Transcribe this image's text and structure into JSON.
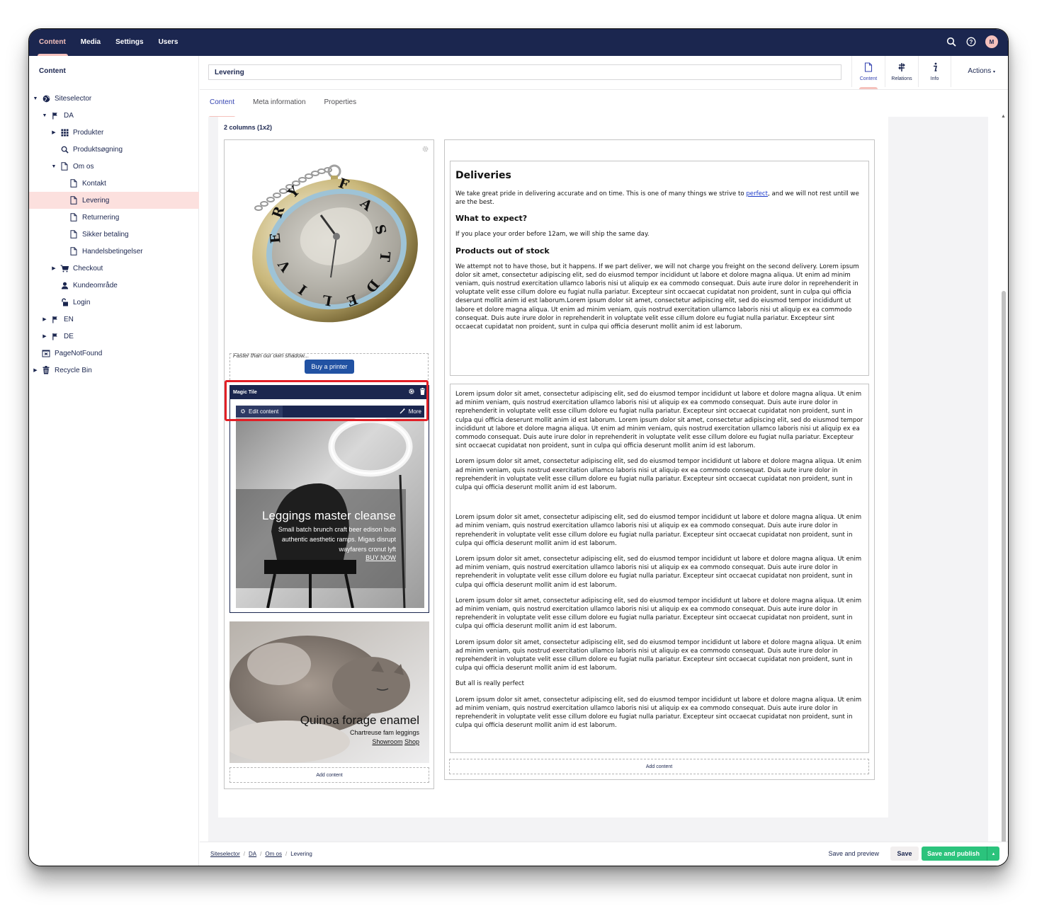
{
  "topnav": {
    "items": [
      {
        "label": "Content",
        "active": true
      },
      {
        "label": "Media"
      },
      {
        "label": "Settings"
      },
      {
        "label": "Users"
      }
    ],
    "avatar_initial": "M"
  },
  "sidebar": {
    "title": "Content",
    "tree": [
      {
        "label": "Siteselector",
        "level": 0,
        "caret": "open",
        "icon": "globe-icon"
      },
      {
        "label": "DA",
        "level": 1,
        "caret": "open",
        "icon": "flag-icon"
      },
      {
        "label": "Produkter",
        "level": 2,
        "caret": "closed",
        "icon": "grid-icon"
      },
      {
        "label": "Produktsøgning",
        "level": 2,
        "caret": "",
        "icon": "search-icon"
      },
      {
        "label": "Om os",
        "level": 2,
        "caret": "open",
        "icon": "document-icon"
      },
      {
        "label": "Kontakt",
        "level": 3,
        "caret": "",
        "icon": "document-icon"
      },
      {
        "label": "Levering",
        "level": 3,
        "caret": "",
        "icon": "document-icon",
        "selected": true
      },
      {
        "label": "Returnering",
        "level": 3,
        "caret": "",
        "icon": "document-icon"
      },
      {
        "label": "Sikker betaling",
        "level": 3,
        "caret": "",
        "icon": "document-icon"
      },
      {
        "label": "Handelsbetingelser",
        "level": 3,
        "caret": "",
        "icon": "document-icon"
      },
      {
        "label": "Checkout",
        "level": 2,
        "caret": "closed",
        "icon": "cart-icon"
      },
      {
        "label": "Kundeområde",
        "level": 2,
        "caret": "",
        "icon": "user-icon"
      },
      {
        "label": "Login",
        "level": 2,
        "caret": "",
        "icon": "unlock-icon"
      },
      {
        "label": "EN",
        "level": 1,
        "caret": "closed",
        "icon": "flag-icon"
      },
      {
        "label": "DE",
        "level": 1,
        "caret": "closed",
        "icon": "flag-icon"
      },
      {
        "label": "PageNotFound",
        "level": 0,
        "caret": "",
        "icon": "page-not-found-icon"
      },
      {
        "label": "Recycle Bin",
        "level": 0,
        "caret": "closed",
        "icon": "trash-icon"
      }
    ]
  },
  "header": {
    "name_value": "Levering",
    "apps": [
      {
        "label": "Content",
        "icon": "document-icon",
        "active": true
      },
      {
        "label": "Relations",
        "icon": "relations-icon"
      },
      {
        "label": "Info",
        "icon": "info-icon"
      }
    ],
    "actions_label": "Actions"
  },
  "tabs": [
    {
      "label": "Content",
      "active": true
    },
    {
      "label": "Meta information"
    },
    {
      "label": "Properties"
    }
  ],
  "grid": {
    "label": "2 columns (1x2)",
    "left": {
      "caption": "Faster than our own shadow...",
      "watch_letters": [
        "F",
        "A",
        "S",
        "T",
        "D",
        "E",
        "L",
        "I",
        "V",
        "E",
        "R",
        "Y"
      ],
      "buy_button": "Buy a printer",
      "magic_tile": {
        "title": "Magic Tile",
        "edit_label": "Edit content",
        "more_label": "More",
        "heading": "Leggings master cleanse",
        "lines": [
          "Small batch brunch craft beer edison bulb",
          "authentic aesthetic ramps. Migas disrupt",
          "wayfarers cronut lyft"
        ],
        "link": "BUY NOW"
      },
      "cat_tile": {
        "heading": "Quinoa forage enamel",
        "sub": "Chartreuse fam leggings",
        "link1": "Showroom",
        "link2": "Shop"
      },
      "add_content": "Add content"
    },
    "right": {
      "rte1": {
        "h1": "Deliveries",
        "p1_before": "We take great pride in delivering accurate and on time. This is one of many things we strive to ",
        "p1_link": "perfect",
        "p1_after": ", and we will not rest untill we are the best.",
        "h2a": "What to expect?",
        "p2": "If you place your order before 12am, we will ship the same day.",
        "h2b": "Products out of stock",
        "p3": "We attempt not to have those, but it happens. If we part deliver, we will not charge you freight on the second delivery. Lorem ipsum dolor sit amet, consectetur adipiscing elit, sed do eiusmod tempor incididunt ut labore et dolore magna aliqua. Ut enim ad minim veniam, quis nostrud exercitation ullamco laboris nisi ut aliquip ex ea commodo consequat. Duis aute irure dolor in reprehenderit in voluptate velit esse cillum dolore eu fugiat nulla pariatur. Excepteur sint occaecat cupidatat non proident, sunt in culpa qui officia deserunt mollit anim id est laborum.Lorem ipsum dolor sit amet, consectetur adipiscing elit, sed do eiusmod tempor incididunt ut labore et dolore magna aliqua. Ut enim ad minim veniam, quis nostrud exercitation ullamco laboris nisi ut aliquip ex ea commodo consequat. Duis aute irure dolor in reprehenderit in voluptate velit esse cillum dolore eu fugiat nulla pariatur. Excepteur sint occaecat cupidatat non proident, sunt in culpa qui officia deserunt mollit anim id est laborum."
      },
      "rte2": {
        "p1": "Lorem ipsum dolor sit amet, consectetur adipiscing elit, sed do eiusmod tempor incididunt ut labore et dolore magna aliqua. Ut enim ad minim veniam, quis nostrud exercitation ullamco laboris nisi ut aliquip ex ea commodo consequat. Duis aute irure dolor in reprehenderit in voluptate velit esse cillum dolore eu fugiat nulla pariatur. Excepteur sint occaecat cupidatat non proident, sunt in culpa qui officia deserunt mollit anim id est laborum. Lorem ipsum dolor sit amet, consectetur adipiscing elit, sed do eiusmod tempor incididunt ut labore et dolore magna aliqua. Ut enim ad minim veniam, quis nostrud exercitation ullamco laboris nisi ut aliquip ex ea commodo consequat. Duis aute irure dolor in reprehenderit in voluptate velit esse cillum dolore eu fugiat nulla pariatur. Excepteur sint occaecat cupidatat non proident, sunt in culpa qui officia deserunt mollit anim id est laborum.",
        "lorem": "Lorem ipsum dolor sit amet, consectetur adipiscing elit, sed do eiusmod tempor incididunt ut labore et dolore magna aliqua. Ut enim ad minim veniam, quis nostrud exercitation ullamco laboris nisi ut aliquip ex ea commodo consequat. Duis aute irure dolor in reprehenderit in voluptate velit esse cillum dolore eu fugiat nulla pariatur. Excepteur sint occaecat cupidatat non proident, sunt in culpa qui officia deserunt mollit anim id est laborum.",
        "perfect_line": "But all is really perfect"
      },
      "add_content": "Add content"
    }
  },
  "footer": {
    "breadcrumbs": [
      "Siteselector",
      "DA",
      "Om os",
      "Levering"
    ],
    "save_preview": "Save and preview",
    "save": "Save",
    "save_publish": "Save and publish"
  }
}
